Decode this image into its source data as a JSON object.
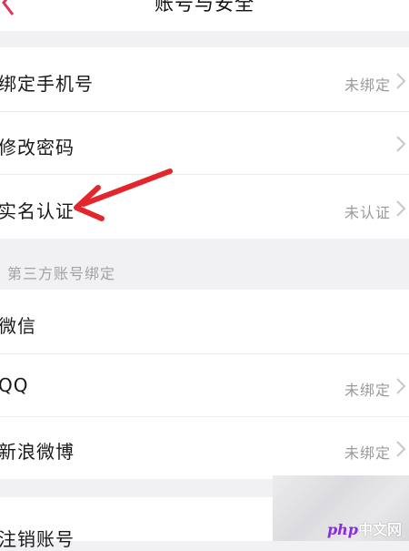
{
  "header": {
    "title": "账号与安全"
  },
  "account_section": {
    "items": [
      {
        "label": "绑定手机号",
        "status": "未绑定"
      },
      {
        "label": "修改密码",
        "status": ""
      },
      {
        "label": "实名认证",
        "status": "未认证"
      }
    ]
  },
  "third_party": {
    "title": "第三方账号绑定",
    "items": [
      {
        "label": "微信",
        "status": ""
      },
      {
        "label": "QQ",
        "status": "未绑定"
      },
      {
        "label": "新浪微博",
        "status": "未绑定"
      }
    ]
  },
  "cancel_account": {
    "label": "注销账号"
  },
  "watermark": {
    "text_latin": "php",
    "text_cn": "中文网"
  },
  "colors": {
    "arrow": "#e3262b",
    "chevron": "#c8c8c8",
    "status": "#9a9a9a"
  },
  "icons": [
    "back-icon",
    "chevron-right-icon"
  ]
}
